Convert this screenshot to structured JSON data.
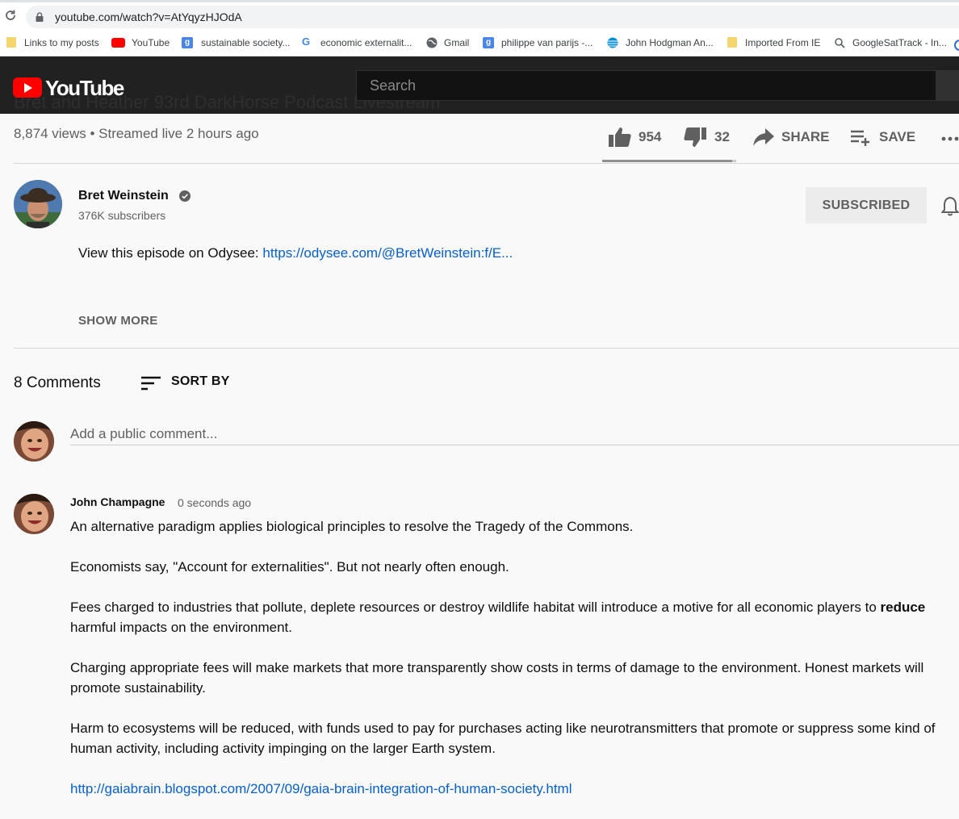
{
  "browser": {
    "url": "youtube.com/watch?v=AtYqyzHJOdA",
    "bookmarks": [
      {
        "label": "Links to my posts",
        "icon": "folder-icon"
      },
      {
        "label": "YouTube",
        "icon": "youtube-icon"
      },
      {
        "label": "sustainable society...",
        "icon": "g-square-icon"
      },
      {
        "label": "economic externalit...",
        "icon": "google-icon"
      },
      {
        "label": "Gmail",
        "icon": "globe-icon"
      },
      {
        "label": "philippe van parijs -...",
        "icon": "g-square-icon"
      },
      {
        "label": "John Hodgman An...",
        "icon": "att-icon"
      },
      {
        "label": "Imported From IE",
        "icon": "folder-icon"
      },
      {
        "label": "GoogleSatTrack - In...",
        "icon": "satellite-icon"
      }
    ]
  },
  "masthead": {
    "logo_text": "YouTube",
    "search_placeholder": "Search",
    "ghost_title": "Bret and Heather 93rd DarkHorse Podcast Livestream"
  },
  "video": {
    "views_line": "8,874 views • Streamed live 2 hours ago",
    "likes": "954",
    "dislikes": "32",
    "like_ratio": 0.968,
    "share_label": "SHARE",
    "save_label": "SAVE"
  },
  "channel": {
    "name": "Bret Weinstein",
    "subscribers": "376K subscribers",
    "subscribe_label": "SUBSCRIBED",
    "description_prefix": "View this episode on Odysee: ",
    "description_link": "https://odysee.com/@BretWeinstein:f/E...",
    "show_more": "SHOW MORE"
  },
  "comments": {
    "count_label": "8 Comments",
    "sort_label": "SORT BY",
    "add_placeholder": "Add a public comment...",
    "items": [
      {
        "author": "John Champagne",
        "time": "0 seconds ago",
        "p1": "An alternative paradigm applies biological principles to resolve the Tragedy of the Commons.",
        "p2": "Economists say, \"Account for externalities\". But not nearly often enough.",
        "p3_a": "Fees charged to industries that pollute, deplete resources or destroy wildlife habitat will introduce a motive for all economic players to ",
        "p3_b": "reduce",
        "p3_c": " harmful impacts on the environment.",
        "p4": "Charging appropriate fees will make markets that more transparently show costs in terms of damage to the environment. Honest markets will promote sustainability.",
        "p5": "Harm to ecosystems will be reduced, with funds used to pay for purchases acting like neurotransmitters that promote or suppress some kind of human activity, including activity impinging on the larger Earth system.",
        "link": "http://gaiabrain.blogspot.com/2007/09/gaia-brain-integration-of-human-society.html"
      }
    ]
  },
  "colors": {
    "link": "#065fd4",
    "masthead": "#212121",
    "brand_red": "#ff0000",
    "secondary_text": "#606060"
  }
}
